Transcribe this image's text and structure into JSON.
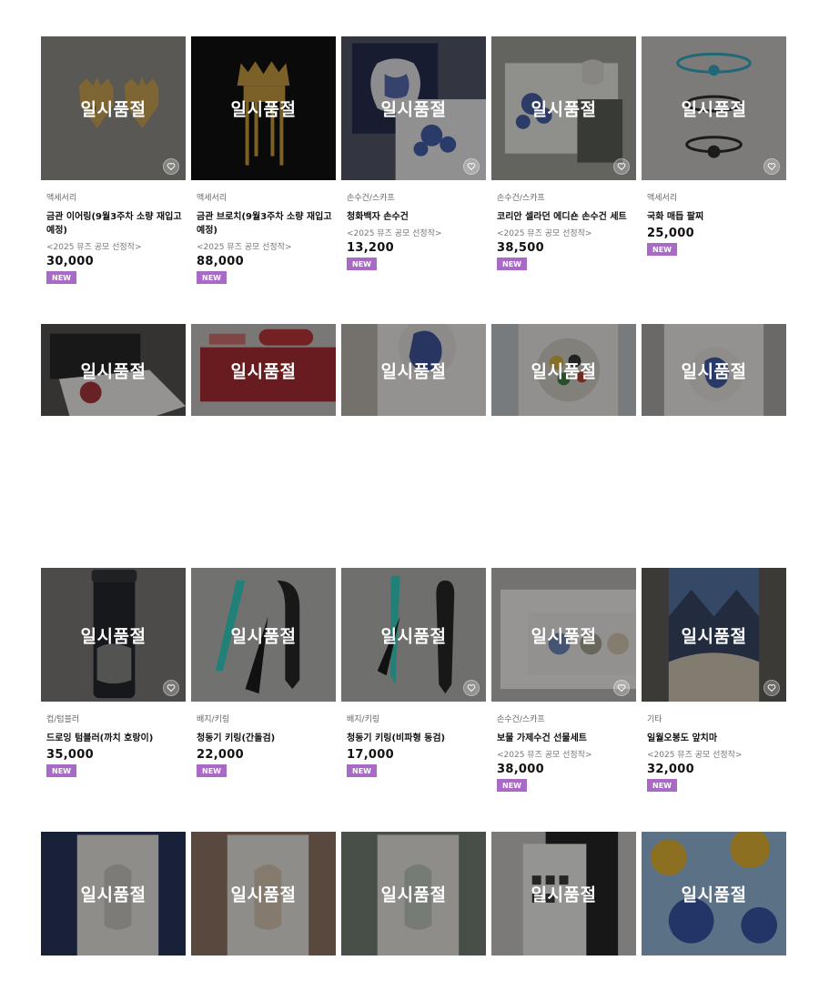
{
  "soldout_label": "일시품절",
  "rows": [
    [
      {
        "category": "액세서리",
        "name": "금관 이어링(9월3주차 소량 재입고 예정)",
        "tag": "<2025 뮤즈 공모 선정작>",
        "price": "30,000",
        "badge": "NEW",
        "art": "earring",
        "heart": true
      },
      {
        "category": "액세서리",
        "name": "금관 브로치(9월3주차 소량 재입고 예정)",
        "tag": "<2025 뮤즈 공모 선정작>",
        "price": "88,000",
        "badge": "NEW",
        "art": "brooch",
        "heart": false
      },
      {
        "category": "손수건/스카프",
        "name": "청화백자 손수건",
        "tag": "<2025 뮤즈 공모 선정작>",
        "price": "13,200",
        "badge": "NEW",
        "art": "porcelain",
        "heart": true
      },
      {
        "category": "손수건/스카프",
        "name": "코리안 셀라던 에디숀 손수건 세트",
        "tag": "<2025 뮤즈 공모 선정작>",
        "price": "38,500",
        "badge": "NEW",
        "art": "celadon",
        "heart": true
      },
      {
        "category": "액세서리",
        "name": "국화 매듭 팔찌",
        "tag": "",
        "price": "25,000",
        "badge": "NEW",
        "art": "bracelet",
        "heart": true
      }
    ],
    [
      {
        "art": "box"
      },
      {
        "art": "redcase"
      },
      {
        "art": "tigerplate"
      },
      {
        "art": "palette"
      },
      {
        "art": "tigercard"
      }
    ],
    [
      {
        "category": "컵/텀블러",
        "name": "드로잉 텀블러(까치 호랑이)",
        "tag": "",
        "price": "35,000",
        "badge": "NEW",
        "art": "tumbler",
        "heart": true
      },
      {
        "category": "배지/키링",
        "name": "청동기 키링(간돌검)",
        "tag": "",
        "price": "22,000",
        "badge": "NEW",
        "art": "keyring1",
        "heart": false
      },
      {
        "category": "배지/키링",
        "name": "청동기 키링(비파형 동검)",
        "tag": "",
        "price": "17,000",
        "badge": "NEW",
        "art": "keyring2",
        "heart": true
      },
      {
        "category": "손수건/스카프",
        "name": "보물 가제수건 선물세트",
        "tag": "<2025 뮤즈 공모 선정작>",
        "price": "38,000",
        "badge": "NEW",
        "art": "giftset",
        "heart": true
      },
      {
        "category": "기타",
        "name": "일월오봉도 앞치마",
        "tag": "<2025 뮤즈 공모 선정작>",
        "price": "32,000",
        "badge": "NEW",
        "art": "apron",
        "heart": true
      }
    ],
    [
      {
        "art": "book_navy"
      },
      {
        "art": "book_brown"
      },
      {
        "art": "book_green"
      },
      {
        "art": "cards"
      },
      {
        "art": "tigers"
      }
    ]
  ]
}
